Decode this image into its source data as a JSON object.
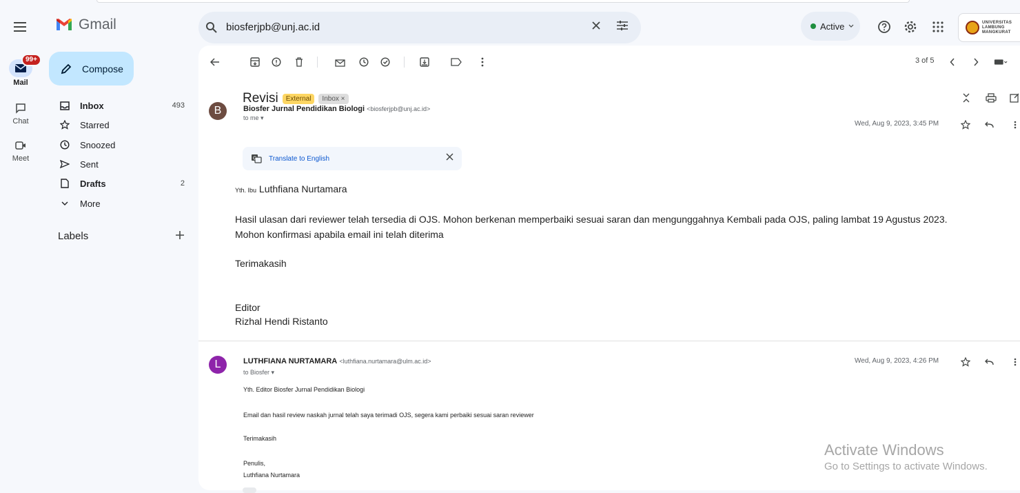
{
  "app": {
    "name": "Gmail"
  },
  "rail": {
    "items": [
      {
        "label": "Mail",
        "icon": "mail-icon",
        "badge": "99+"
      },
      {
        "label": "Chat",
        "icon": "chat-icon"
      },
      {
        "label": "Meet",
        "icon": "video-icon"
      }
    ]
  },
  "search": {
    "value": "biosferjpb@unj.ac.id"
  },
  "header": {
    "status": "Active",
    "account_text": "UNIVERSITAS LAMBUNG MANGKURAT"
  },
  "nav": {
    "compose": "Compose",
    "items": [
      {
        "label": "Inbox",
        "count": "493",
        "icon": "inbox-icon",
        "bold": true
      },
      {
        "label": "Starred",
        "count": "",
        "icon": "star-icon",
        "bold": false
      },
      {
        "label": "Snoozed",
        "count": "",
        "icon": "clock-icon",
        "bold": false
      },
      {
        "label": "Sent",
        "count": "",
        "icon": "send-icon",
        "bold": false
      },
      {
        "label": "Drafts",
        "count": "2",
        "icon": "draft-icon",
        "bold": true
      },
      {
        "label": "More",
        "count": "",
        "icon": "chevron-down-icon",
        "bold": false
      }
    ],
    "labels_title": "Labels"
  },
  "toolbar": {
    "pager": "3 of 5"
  },
  "thread": {
    "subject": "Revisi",
    "tags": [
      "External",
      "Inbox ×"
    ],
    "messages": [
      {
        "avatar": "B",
        "avatar_color": "#6d4c41",
        "sender_name": "Biosfer Jurnal Pendidikan Biologi",
        "sender_email": "<biosferjpb@unj.ac.id>",
        "recipients": "to me ▾",
        "date": "Wed, Aug 9, 2023, 3:45 PM",
        "translate": "Translate to English",
        "greeting_prefix": "Yth. Ibu",
        "greeting_name": "Luthfiana Nurtamara",
        "para1": "Hasil ulasan dari reviewer telah tersedia di OJS. Mohon berkenan memperbaiki sesuai saran dan mengunggahnya Kembali pada OJS, paling lambat 19 Agustus 2023.",
        "para2": "Mohon konfirmasi apabila email ini telah diterima",
        "thanks": "Terimakasih",
        "sign_role": "Editor",
        "sign_name": "Rizhal Hendi Ristanto"
      },
      {
        "avatar": "L",
        "avatar_color": "#8e24aa",
        "sender_name": "LUTHFIANA NURTAMARA",
        "sender_email": "<luthfiana.nurtamara@ulm.ac.id>",
        "recipients": "to Biosfer ▾",
        "date": "Wed, Aug 9, 2023, 4:26 PM",
        "greeting": "Yth. Editor Biosfer Jurnal Pendidikan Biologi",
        "para1": "Email dan hasil review naskah jurnal telah saya terimadi OJS, segera kami perbaiki sesuai saran reviewer",
        "thanks": "Terimakasih",
        "sign_role": "Penulis,",
        "sign_name": "Luthfiana Nurtamara"
      }
    ]
  },
  "watermark": {
    "title": "Activate Windows",
    "subtitle": "Go to Settings to activate Windows."
  }
}
